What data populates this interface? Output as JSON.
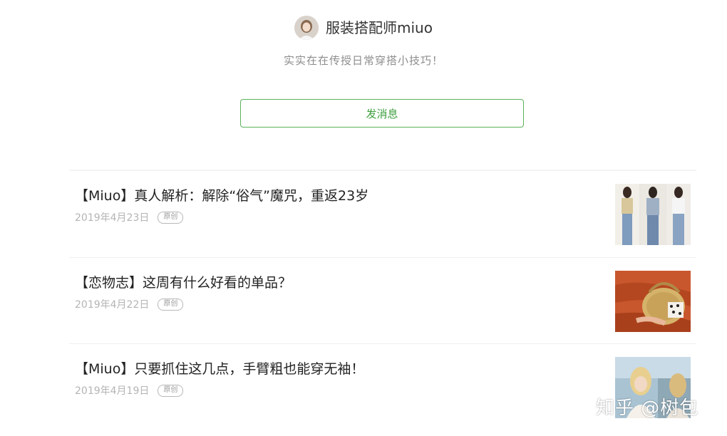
{
  "profile": {
    "name": "服装搭配师miuo",
    "signature": "实实在在传授日常穿搭小技巧！",
    "message_button": "发消息"
  },
  "articles": [
    {
      "title": "【Miuo】真人解析：解除“俗气”魔咒，重返23岁",
      "date": "2019年4月23日",
      "badge": "原创",
      "thumbnail": "three-outfits-photo"
    },
    {
      "title": "【恋物志】这周有什么好看的单品？",
      "date": "2019年4月22日",
      "badge": "原创",
      "thumbnail": "straw-bag-photo"
    },
    {
      "title": "【Miuo】只要抓住这几点，手臂粗也能穿无袖！",
      "date": "2019年4月19日",
      "badge": "原创",
      "thumbnail": "blonde-women-photo"
    }
  ],
  "watermark": "知乎 @树包",
  "colors": {
    "accent_green": "#3e9e3e",
    "border_green": "#5ab25a",
    "muted_text": "#b4b4b4"
  }
}
